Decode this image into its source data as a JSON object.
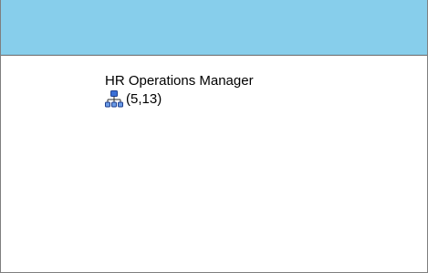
{
  "header": {
    "color": "#87ceeb"
  },
  "node": {
    "title": "HR Operations Manager",
    "coords": "(5,13)",
    "icon": "org-chart-icon"
  }
}
